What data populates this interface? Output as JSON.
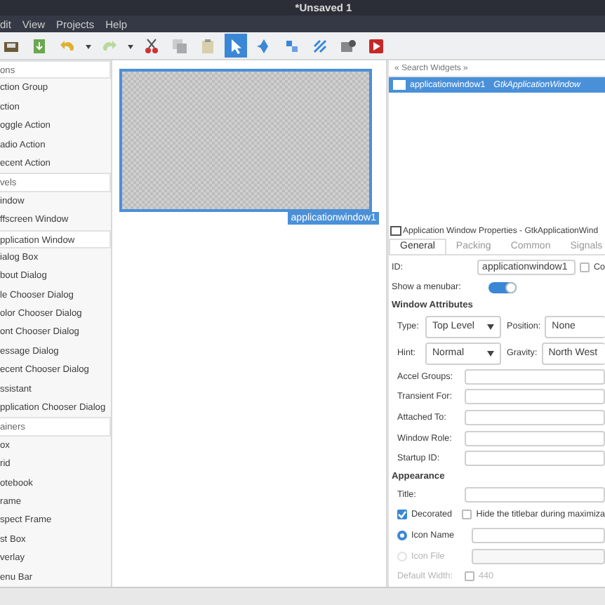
{
  "window": {
    "title": "*Unsaved 1"
  },
  "menu": [
    "dit",
    "View",
    "Projects",
    "Help"
  ],
  "toolbar": [
    {
      "kind": "save",
      "selected": false
    },
    {
      "kind": "download",
      "selected": false
    },
    {
      "kind": "undo",
      "selected": false
    },
    {
      "kind": "caret",
      "selected": false
    },
    {
      "kind": "redo",
      "selected": false
    },
    {
      "kind": "caret",
      "selected": false
    },
    {
      "kind": "cut",
      "selected": false
    },
    {
      "kind": "copy",
      "selected": false
    },
    {
      "kind": "paste",
      "selected": false
    },
    {
      "kind": "pointer",
      "selected": true
    },
    {
      "kind": "move",
      "selected": false
    },
    {
      "kind": "align",
      "selected": false
    },
    {
      "kind": "connect",
      "selected": false
    },
    {
      "kind": "preview",
      "selected": false
    },
    {
      "kind": "debug",
      "selected": false
    }
  ],
  "palette": [
    {
      "kind": "header",
      "label": "ons",
      "selected": false
    },
    {
      "kind": "item",
      "label": "ction Group",
      "selected": false
    },
    {
      "kind": "item",
      "label": "ction",
      "selected": false
    },
    {
      "kind": "item",
      "label": "oggle Action",
      "selected": false
    },
    {
      "kind": "item",
      "label": "adio Action",
      "selected": false
    },
    {
      "kind": "item",
      "label": "ecent Action",
      "selected": false
    },
    {
      "kind": "header",
      "label": "vels",
      "selected": false
    },
    {
      "kind": "item",
      "label": "indow",
      "selected": false
    },
    {
      "kind": "item",
      "label": "ffscreen Window",
      "selected": false
    },
    {
      "kind": "item",
      "label": "pplication Window",
      "selected": true
    },
    {
      "kind": "item",
      "label": "ialog Box",
      "selected": false
    },
    {
      "kind": "item",
      "label": "bout Dialog",
      "selected": false
    },
    {
      "kind": "item",
      "label": "le Chooser Dialog",
      "selected": false
    },
    {
      "kind": "item",
      "label": "olor Chooser Dialog",
      "selected": false
    },
    {
      "kind": "item",
      "label": "ont Chooser Dialog",
      "selected": false
    },
    {
      "kind": "item",
      "label": "essage Dialog",
      "selected": false
    },
    {
      "kind": "item",
      "label": "ecent Chooser Dialog",
      "selected": false
    },
    {
      "kind": "item",
      "label": "ssistant",
      "selected": false
    },
    {
      "kind": "item",
      "label": "pplication Chooser Dialog",
      "selected": false
    },
    {
      "kind": "header",
      "label": "ainers",
      "selected": false
    },
    {
      "kind": "item",
      "label": "ox",
      "selected": false
    },
    {
      "kind": "item",
      "label": "rid",
      "selected": false
    },
    {
      "kind": "item",
      "label": "otebook",
      "selected": false
    },
    {
      "kind": "item",
      "label": "rame",
      "selected": false
    },
    {
      "kind": "item",
      "label": "spect Frame",
      "selected": false
    },
    {
      "kind": "item",
      "label": "st Box",
      "selected": false
    },
    {
      "kind": "item",
      "label": "verlay",
      "selected": false
    },
    {
      "kind": "item",
      "label": "enu Bar",
      "selected": false
    }
  ],
  "canvas": {
    "widget_label": "applicationwindow1"
  },
  "inspector": {
    "search_placeholder": "« Search Widgets »",
    "rows": [
      {
        "name": "applicationwindow1",
        "type": "GtkApplicationWindow",
        "selected": true
      }
    ]
  },
  "properties": {
    "title": "Application Window Properties - GtkApplicationWind",
    "tabs": [
      {
        "label": "General",
        "selected": true
      },
      {
        "label": "Packing",
        "selected": false
      },
      {
        "label": "Common",
        "selected": false
      },
      {
        "label": "Signals",
        "selected": false
      }
    ],
    "id": {
      "label": "ID:",
      "value": "applicationwindow1",
      "check_label": "Co",
      "checked": false
    },
    "menubar": {
      "label": "Show a menubar:",
      "on": true
    },
    "window_attributes": "Window Attributes",
    "combos": [
      {
        "label": "Type:",
        "value": "Top Level",
        "label2": "Position:",
        "value2": "None"
      },
      {
        "label": "Hint:",
        "value": "Normal",
        "label2": "Gravity:",
        "value2": "North West"
      }
    ],
    "fields": [
      "Accel Groups:",
      "Transient For:",
      "Attached To:",
      "Window Role:",
      "Startup ID:"
    ],
    "appearance": "Appearance",
    "title_field": "Title:",
    "decorated": {
      "label": "Decorated",
      "checked": true,
      "hide_label": "Hide the titlebar during maximiza",
      "hide_checked": false
    },
    "icon_options": [
      {
        "label": "Icon Name",
        "selected": true,
        "disabled": false
      },
      {
        "label": "Icon File",
        "selected": false,
        "disabled": true
      }
    ],
    "default_width": {
      "label": "Default Width:",
      "checked": false,
      "value": "440"
    }
  }
}
